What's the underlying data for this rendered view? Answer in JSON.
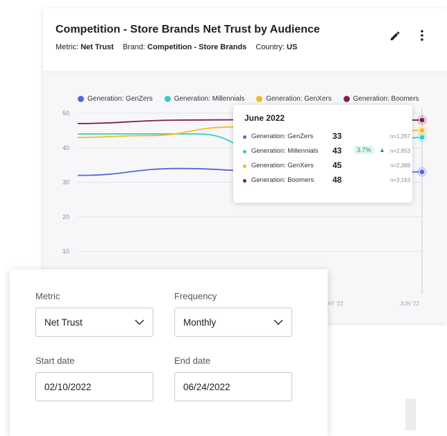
{
  "card": {
    "title": "Competition - Store Brands Net Trust by Audience",
    "meta": {
      "metric_label": "Metric:",
      "metric_value": "Net Trust",
      "brand_label": "Brand:",
      "brand_value": "Competition - Store Brands",
      "country_label": "Country:",
      "country_value": "US"
    },
    "icons": [
      "pencil-icon",
      "more-vert-icon"
    ]
  },
  "chart_data": {
    "type": "line",
    "legend_position": "top",
    "ylim": [
      0,
      50
    ],
    "yticks": [
      "10",
      "20",
      "30",
      "40",
      "50"
    ],
    "x_ticks_visible": [
      "AY '22",
      "JUN '22"
    ],
    "series": [
      {
        "name": "Generation: GenZers",
        "color": "#5567d6",
        "points": [
          [
            0,
            32
          ],
          [
            0.3,
            34
          ],
          [
            0.55,
            33.2
          ],
          [
            0.85,
            33
          ],
          [
            1,
            33
          ]
        ]
      },
      {
        "name": "Generation: Millennials",
        "color": "#2fcfc6",
        "points": [
          [
            0,
            44
          ],
          [
            0.35,
            44
          ],
          [
            0.55,
            39
          ],
          [
            0.75,
            33.5
          ],
          [
            1,
            43
          ]
        ]
      },
      {
        "name": "Generation: GenXers",
        "color": "#f7b924",
        "points": [
          [
            0,
            43
          ],
          [
            0.2,
            43.5
          ],
          [
            0.45,
            46
          ],
          [
            0.8,
            45.5
          ],
          [
            1,
            45
          ]
        ]
      },
      {
        "name": "Generation: Boomers",
        "color": "#7f1f4e",
        "points": [
          [
            0,
            47
          ],
          [
            0.3,
            48
          ],
          [
            0.7,
            48.2
          ],
          [
            1,
            48
          ]
        ]
      }
    ]
  },
  "tooltip": {
    "title": "June 2022",
    "rows": [
      {
        "name": "Generation: GenZers",
        "value": "33",
        "change": "",
        "n": "n=1,267",
        "color": "#5567d6"
      },
      {
        "name": "Generation: Millennials",
        "value": "43",
        "change": "3.7%",
        "n": "n=2,853",
        "color": "#2fcfc6"
      },
      {
        "name": "Generation: GenXers",
        "value": "45",
        "change": "",
        "n": "n=2,388",
        "color": "#f7b924"
      },
      {
        "name": "Generation: Boomers",
        "value": "48",
        "change": "",
        "n": "n=3,163",
        "color": "#7f1f4e"
      }
    ]
  },
  "form": {
    "metric": {
      "label": "Metric",
      "value": "Net Trust"
    },
    "frequency": {
      "label": "Frequency",
      "value": "Monthly"
    },
    "start_date": {
      "label": "Start date",
      "value": "02/10/2022"
    },
    "end_date": {
      "label": "End date",
      "value": "06/24/2022"
    }
  }
}
